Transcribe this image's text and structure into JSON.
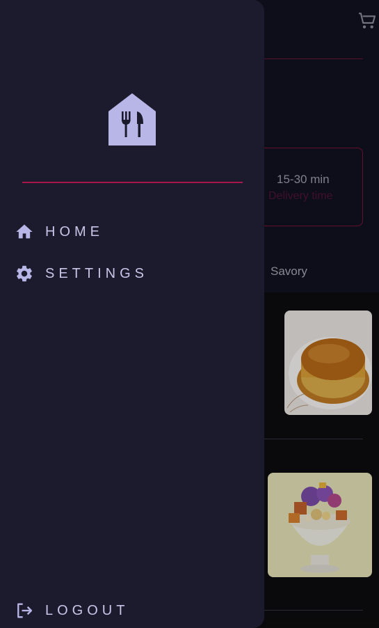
{
  "background": {
    "delivery": {
      "value": "15-30 min",
      "label": "Delivery time"
    },
    "tab_visible": "Savory",
    "food_items": [
      {
        "image": "leche-flan"
      },
      {
        "image": "halo-halo"
      }
    ]
  },
  "drawer": {
    "logo_icon": "restaurant-house-logo",
    "items": [
      {
        "label": "HOME",
        "icon": "home-icon"
      },
      {
        "label": "SETTINGS",
        "icon": "gear-icon"
      }
    ],
    "logout": {
      "label": "LOGOUT",
      "icon": "logout-icon"
    }
  },
  "colors": {
    "drawer_bg": "#1b1b2d",
    "accent": "#a8164a",
    "nav_text": "#c8c6e8",
    "logo": "#b8b6e6"
  }
}
